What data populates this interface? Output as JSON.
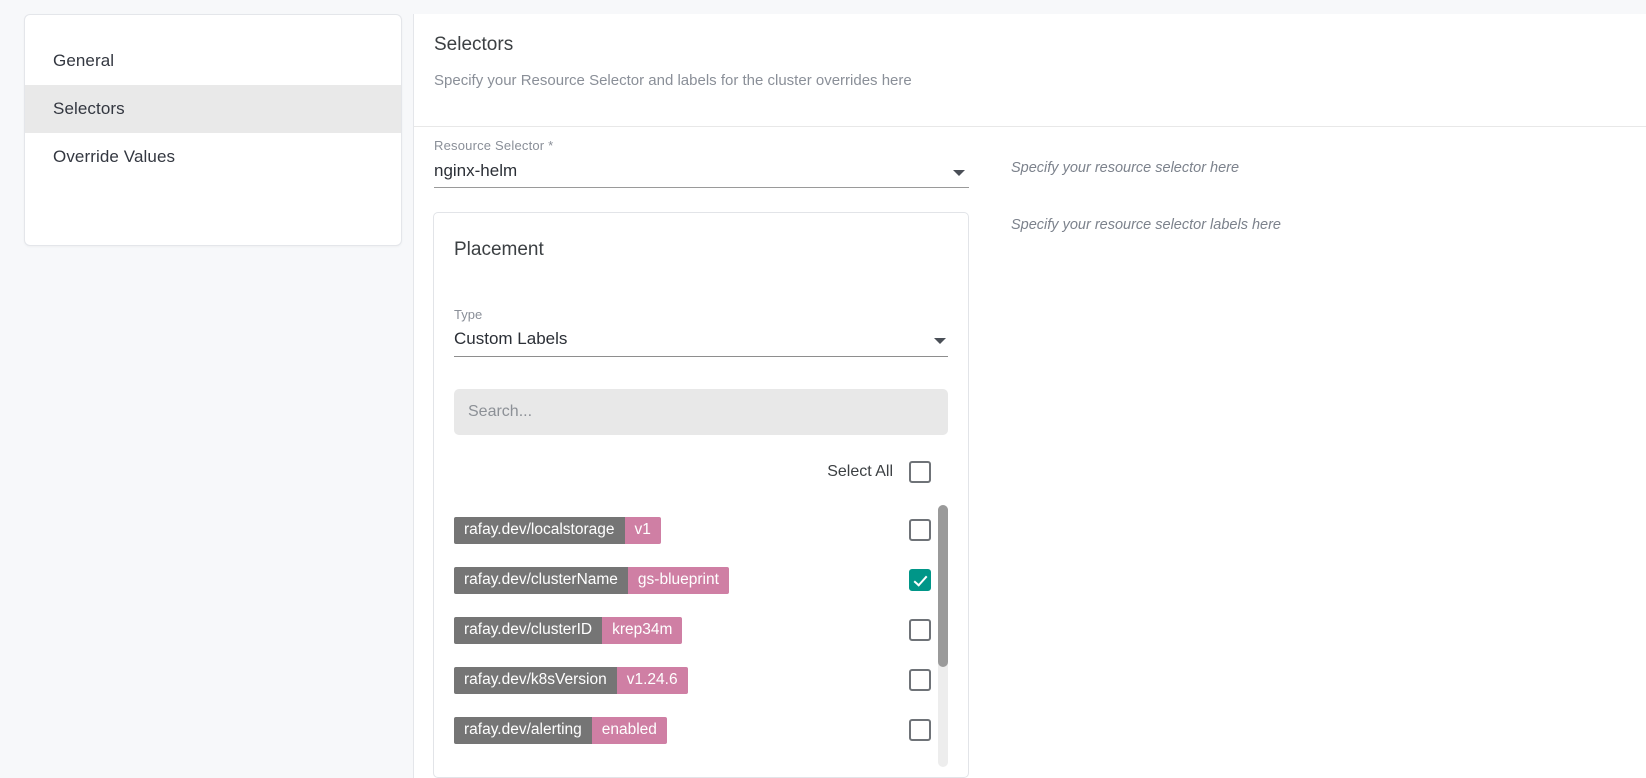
{
  "sidebar": {
    "items": [
      {
        "label": "General",
        "active": false
      },
      {
        "label": "Selectors",
        "active": true
      },
      {
        "label": "Override Values",
        "active": false
      }
    ]
  },
  "panel": {
    "title": "Selectors",
    "subtitle": "Specify your Resource Selector and labels for the cluster overrides here"
  },
  "resource_selector": {
    "label": "Resource Selector *",
    "value": "nginx-helm",
    "caret_icon": "chevron-down-icon"
  },
  "hints": {
    "selector_hint": "Specify your resource selector here",
    "labels_hint": "Specify your resource selector labels here"
  },
  "placement": {
    "title": "Placement",
    "type_label": "Type",
    "type_value": "Custom Labels",
    "search_placeholder": "Search...",
    "search_value": "",
    "select_all_label": "Select All",
    "select_all_checked": false,
    "labels": [
      {
        "key": "rafay.dev/localstorage",
        "value": "v1",
        "checked": false
      },
      {
        "key": "rafay.dev/clusterName",
        "value": "gs-blueprint",
        "checked": true
      },
      {
        "key": "rafay.dev/clusterID",
        "value": "krep34m",
        "checked": false
      },
      {
        "key": "rafay.dev/k8sVersion",
        "value": "v1.24.6",
        "checked": false
      },
      {
        "key": "rafay.dev/alerting",
        "value": "enabled",
        "checked": false
      }
    ]
  },
  "colors": {
    "accent_teal": "#009688",
    "chip_key_gray": "#757575",
    "chip_value_pink": "#cf7fa4",
    "active_nav_bg": "#e9e9e9",
    "page_bg": "#f7f8fa"
  }
}
